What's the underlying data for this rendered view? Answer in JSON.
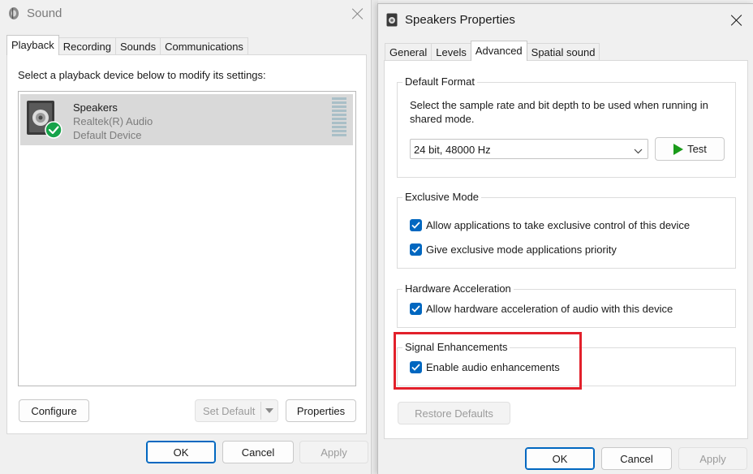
{
  "sound_window": {
    "title": "Sound",
    "tabs": [
      "Playback",
      "Recording",
      "Sounds",
      "Communications"
    ],
    "instruction": "Select a playback device below to modify its settings:",
    "device": {
      "name": "Speakers",
      "driver": "Realtek(R) Audio",
      "status": "Default Device"
    },
    "buttons": {
      "configure": "Configure",
      "set_default": "Set Default",
      "properties": "Properties",
      "ok": "OK",
      "cancel": "Cancel",
      "apply": "Apply"
    }
  },
  "properties_window": {
    "title": "Speakers Properties",
    "tabs": [
      "General",
      "Levels",
      "Advanced",
      "Spatial sound"
    ],
    "active_tab": "Advanced",
    "default_format": {
      "title": "Default Format",
      "description": "Select the sample rate and bit depth to be used when running in shared mode.",
      "selected": "24 bit, 48000 Hz",
      "test_label": "Test"
    },
    "exclusive_mode": {
      "title": "Exclusive Mode",
      "option1": "Allow applications to take exclusive control of this device",
      "option2": "Give exclusive mode applications priority"
    },
    "hardware_acceleration": {
      "title": "Hardware Acceleration",
      "option1": "Allow hardware acceleration of audio with this device"
    },
    "signal_enhancements": {
      "title": "Signal Enhancements",
      "option1": "Enable audio enhancements"
    },
    "restore_defaults": "Restore Defaults",
    "buttons": {
      "ok": "OK",
      "cancel": "Cancel",
      "apply": "Apply"
    }
  },
  "colors": {
    "accent": "#0067c0",
    "highlight_box": "#e2202b",
    "check_green": "#16a34a",
    "test_play_green": "#1a9b1a"
  }
}
